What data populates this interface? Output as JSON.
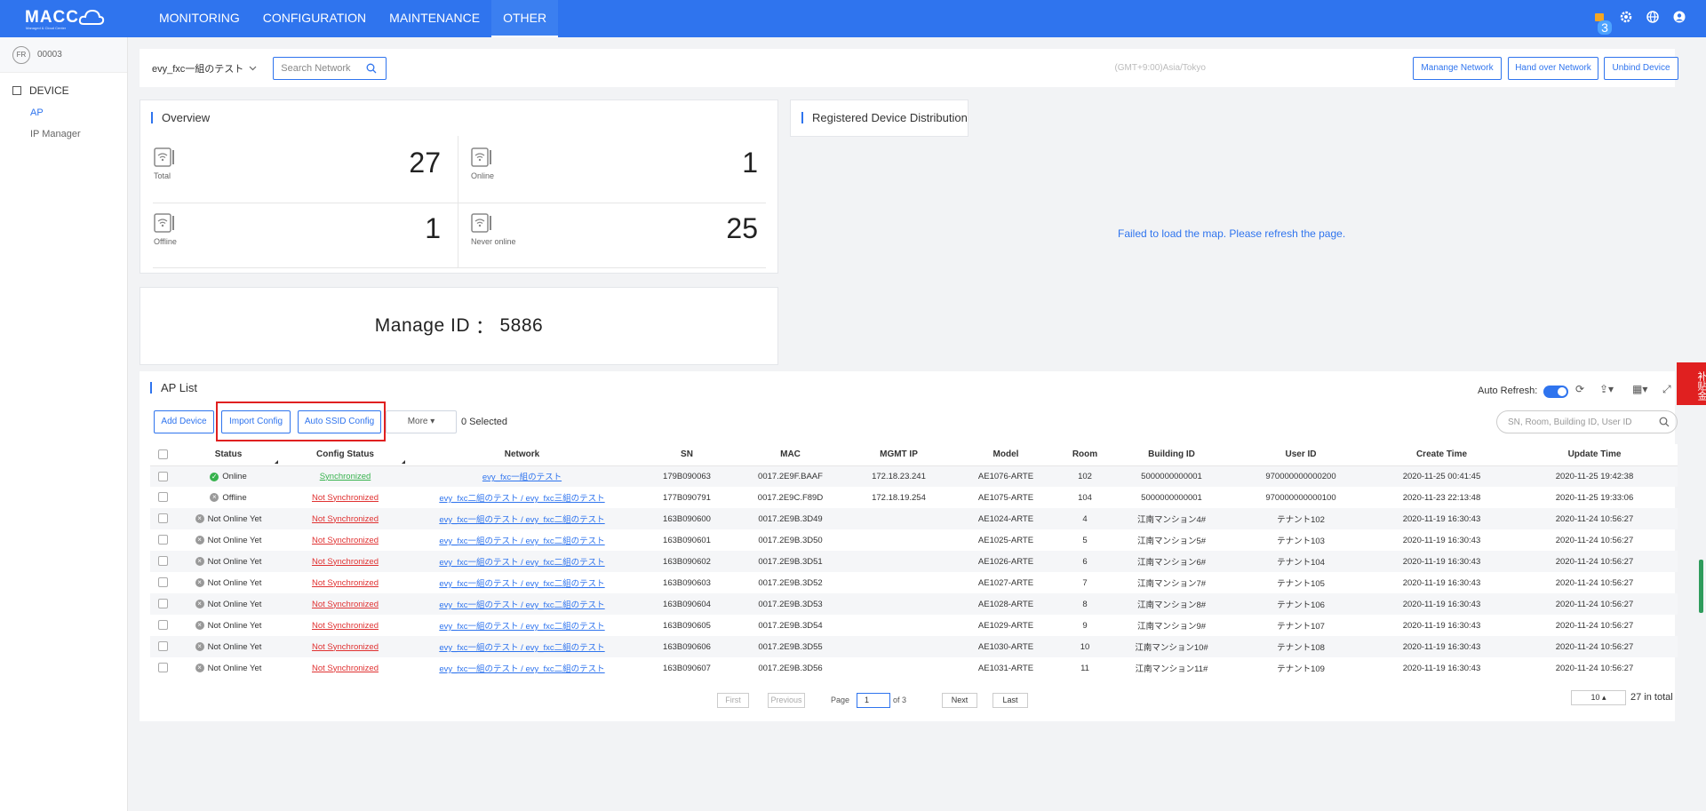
{
  "header": {
    "logo_text": "MACC",
    "logo_subtext": "Managed & Cloud Center",
    "nav": [
      {
        "label": "MONITORING"
      },
      {
        "label": "CONFIGURATION"
      },
      {
        "label": "MAINTENANCE"
      },
      {
        "label": "OTHER"
      }
    ],
    "notification_count": "3",
    "icons": [
      "notification-icon",
      "gear-icon",
      "globe-icon",
      "user-icon"
    ]
  },
  "sidebar": {
    "tenant_avatar": "FR",
    "tenant_id": "00003",
    "group_label": "DEVICE",
    "items": [
      {
        "label": "AP"
      },
      {
        "label": "IP Manager"
      }
    ]
  },
  "toolbar": {
    "network_name": "evy_fxc一組のテスト",
    "search_placeholder": "Search Network",
    "timezone": "(GMT+9:00)Asia/Tokyo",
    "manage_network_label": "Manange Network",
    "hand_over_label": "Hand over Network",
    "unbind_label": "Unbind Device"
  },
  "overview": {
    "title": "Overview",
    "total_label": "Total",
    "total_value": "27",
    "online_label": "Online",
    "online_value": "1",
    "offline_label": "Offline",
    "offline_value": "1",
    "never_label": "Never online",
    "never_value": "25"
  },
  "manage": {
    "label": "Manage ID",
    "separator": "：",
    "value": "5886"
  },
  "distribution": {
    "title": "Registered Device Distribution",
    "message": "Failed to load the map. Please refresh the page."
  },
  "ap_list": {
    "title": "AP List",
    "add_device_label": "Add Device",
    "import_config_label": "Import Config",
    "auto_ssid_label": "Auto SSID Config",
    "more_label": "More",
    "selected_text": "0 Selected",
    "auto_refresh_label": "Auto Refresh:",
    "search_placeholder": "SN, Room, Building ID, User ID",
    "columns": [
      "Status",
      "Config Status",
      "Network",
      "SN",
      "MAC",
      "MGMT IP",
      "Model",
      "Room",
      "Building ID",
      "User ID",
      "Create Time",
      "Update Time"
    ],
    "rows": [
      {
        "status": "Online",
        "config": "Synchronized",
        "network": "evy_fxc一組のテスト",
        "sn": "179B090063",
        "mac": "0017.2E9F.BAAF",
        "ip": "172.18.23.241",
        "model": "AE1076-ARTE",
        "room": "102",
        "building": "5000000000001",
        "user": "970000000000200",
        "create": "2020-11-25 00:41:45",
        "update": "2020-11-25 19:42:38"
      },
      {
        "status": "Offline",
        "config": "Not Synchronized",
        "network": "evy_fxc二組のテスト / evy_fxc三組のテスト",
        "sn": "177B090791",
        "mac": "0017.2E9C.F89D",
        "ip": "172.18.19.254",
        "model": "AE1075-ARTE",
        "room": "104",
        "building": "5000000000001",
        "user": "970000000000100",
        "create": "2020-11-23 22:13:48",
        "update": "2020-11-25 19:33:06"
      },
      {
        "status": "Not Online Yet",
        "config": "Not Synchronized",
        "network": "evy_fxc一組のテスト / evy_fxc二組のテスト",
        "sn": "163B090600",
        "mac": "0017.2E9B.3D49",
        "ip": "",
        "model": "AE1024-ARTE",
        "room": "4",
        "building": "江南マンション4#",
        "user": "テナント102",
        "create": "2020-11-19 16:30:43",
        "update": "2020-11-24 10:56:27"
      },
      {
        "status": "Not Online Yet",
        "config": "Not Synchronized",
        "network": "evy_fxc一組のテスト / evy_fxc二組のテスト",
        "sn": "163B090601",
        "mac": "0017.2E9B.3D50",
        "ip": "",
        "model": "AE1025-ARTE",
        "room": "5",
        "building": "江南マンション5#",
        "user": "テナント103",
        "create": "2020-11-19 16:30:43",
        "update": "2020-11-24 10:56:27"
      },
      {
        "status": "Not Online Yet",
        "config": "Not Synchronized",
        "network": "evy_fxc一組のテスト / evy_fxc二組のテスト",
        "sn": "163B090602",
        "mac": "0017.2E9B.3D51",
        "ip": "",
        "model": "AE1026-ARTE",
        "room": "6",
        "building": "江南マンション6#",
        "user": "テナント104",
        "create": "2020-11-19 16:30:43",
        "update": "2020-11-24 10:56:27"
      },
      {
        "status": "Not Online Yet",
        "config": "Not Synchronized",
        "network": "evy_fxc一組のテスト / evy_fxc二組のテスト",
        "sn": "163B090603",
        "mac": "0017.2E9B.3D52",
        "ip": "",
        "model": "AE1027-ARTE",
        "room": "7",
        "building": "江南マンション7#",
        "user": "テナント105",
        "create": "2020-11-19 16:30:43",
        "update": "2020-11-24 10:56:27"
      },
      {
        "status": "Not Online Yet",
        "config": "Not Synchronized",
        "network": "evy_fxc一組のテスト / evy_fxc二組のテスト",
        "sn": "163B090604",
        "mac": "0017.2E9B.3D53",
        "ip": "",
        "model": "AE1028-ARTE",
        "room": "8",
        "building": "江南マンション8#",
        "user": "テナント106",
        "create": "2020-11-19 16:30:43",
        "update": "2020-11-24 10:56:27"
      },
      {
        "status": "Not Online Yet",
        "config": "Not Synchronized",
        "network": "evy_fxc一組のテスト / evy_fxc二組のテスト",
        "sn": "163B090605",
        "mac": "0017.2E9B.3D54",
        "ip": "",
        "model": "AE1029-ARTE",
        "room": "9",
        "building": "江南マンション9#",
        "user": "テナント107",
        "create": "2020-11-19 16:30:43",
        "update": "2020-11-24 10:56:27"
      },
      {
        "status": "Not Online Yet",
        "config": "Not Synchronized",
        "network": "evy_fxc一組のテスト / evy_fxc二組のテスト",
        "sn": "163B090606",
        "mac": "0017.2E9B.3D55",
        "ip": "",
        "model": "AE1030-ARTE",
        "room": "10",
        "building": "江南マンション10#",
        "user": "テナント108",
        "create": "2020-11-19 16:30:43",
        "update": "2020-11-24 10:56:27"
      },
      {
        "status": "Not Online Yet",
        "config": "Not Synchronized",
        "network": "evy_fxc一組のテスト / evy_fxc二組のテスト",
        "sn": "163B090607",
        "mac": "0017.2E9B.3D56",
        "ip": "",
        "model": "AE1031-ARTE",
        "room": "11",
        "building": "江南マンション11#",
        "user": "テナント109",
        "create": "2020-11-19 16:30:43",
        "update": "2020-11-24 10:56:27"
      }
    ],
    "pagination": {
      "first": "First",
      "previous": "Previous",
      "page_label": "Page",
      "page_value": "1",
      "of_text": "of 3",
      "next": "Next",
      "last": "Last",
      "page_size": "10",
      "total_text": "27 in total"
    }
  },
  "promo_text": "补贴金",
  "colors": {
    "brand": "#2f74ee",
    "online": "#37b24d",
    "not_sync": "#e03131",
    "highlight_box": "#e02020"
  }
}
